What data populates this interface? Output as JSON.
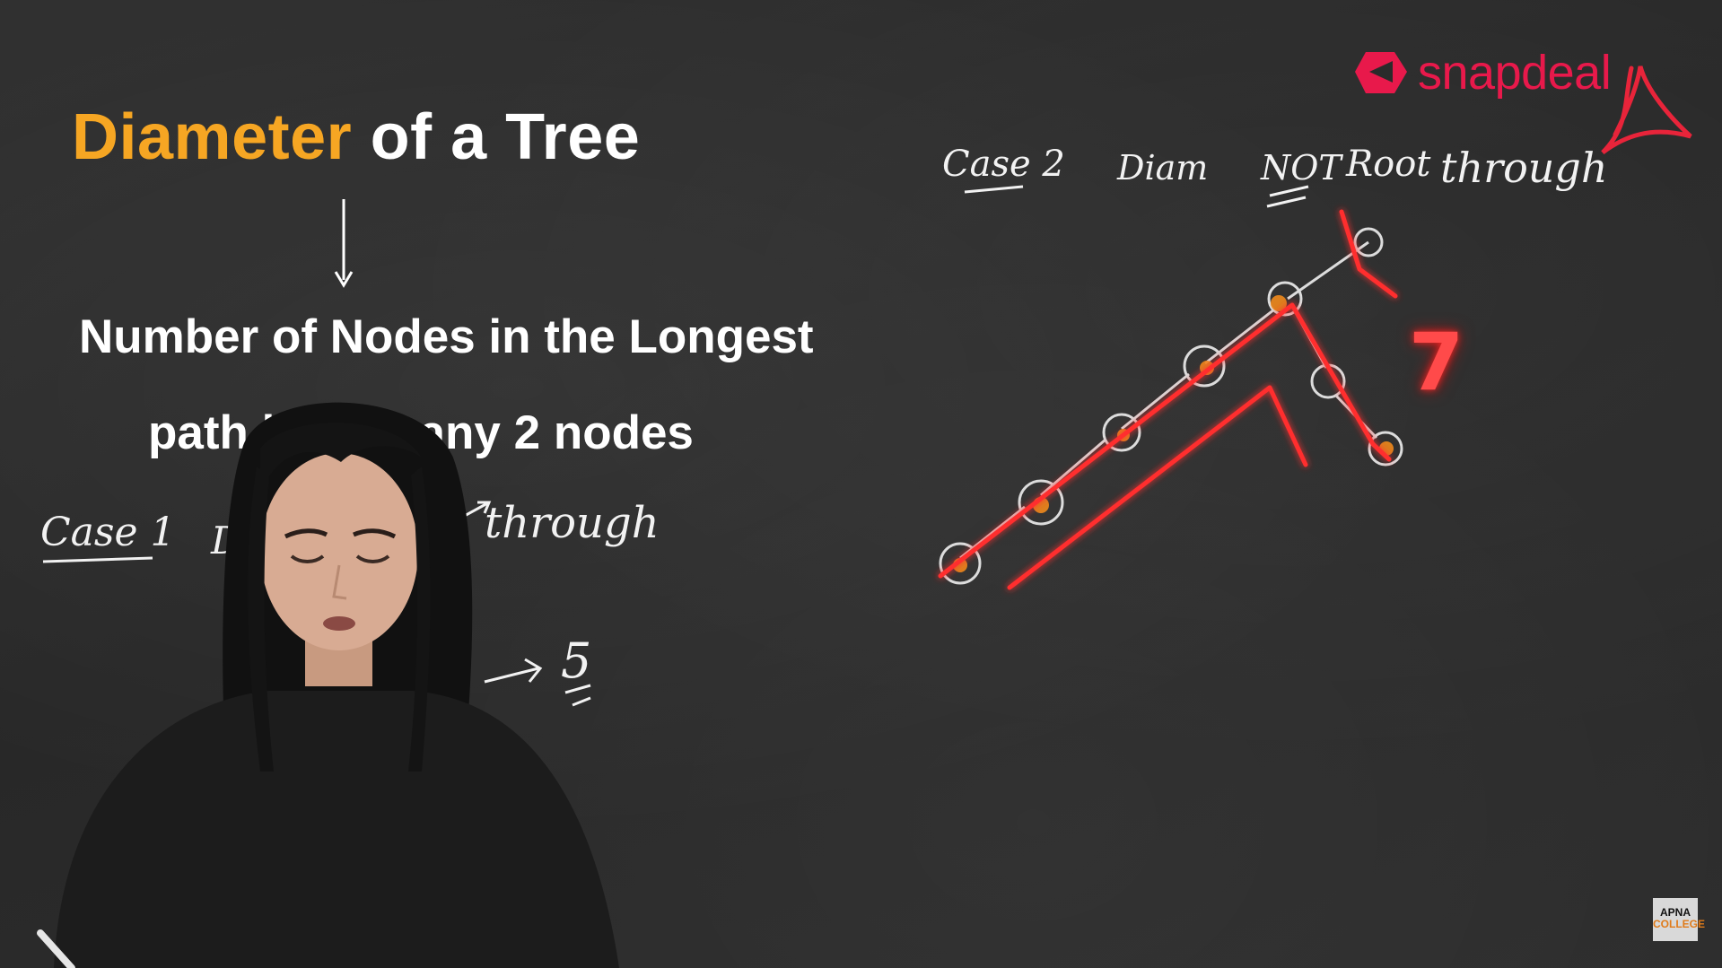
{
  "lecture": {
    "title_accent": "Diameter",
    "title_rest": " of a Tree",
    "definition_line_1": "Number of Nodes in the Longest",
    "definition_line_2": "path b         n any 2 nodes"
  },
  "notes": {
    "case1_label": "Case 1",
    "case1_fragment": "Di",
    "case1_through": "through",
    "case1_answer": "5",
    "case2_label": "Case 2",
    "case2_diam": "Diam",
    "case2_not": "NOT",
    "case2_root": "Root",
    "case2_through": "through",
    "case2_answer": "7"
  },
  "branding": {
    "snapdeal": "snapdeal",
    "apna_line_1": "APNA",
    "apna_line_2": "COLLEGE"
  },
  "colors": {
    "accent": "#f6a623",
    "annotation_red": "#ff3030",
    "snapdeal_red": "#e8194b",
    "chalk": "#f2f2f2"
  }
}
